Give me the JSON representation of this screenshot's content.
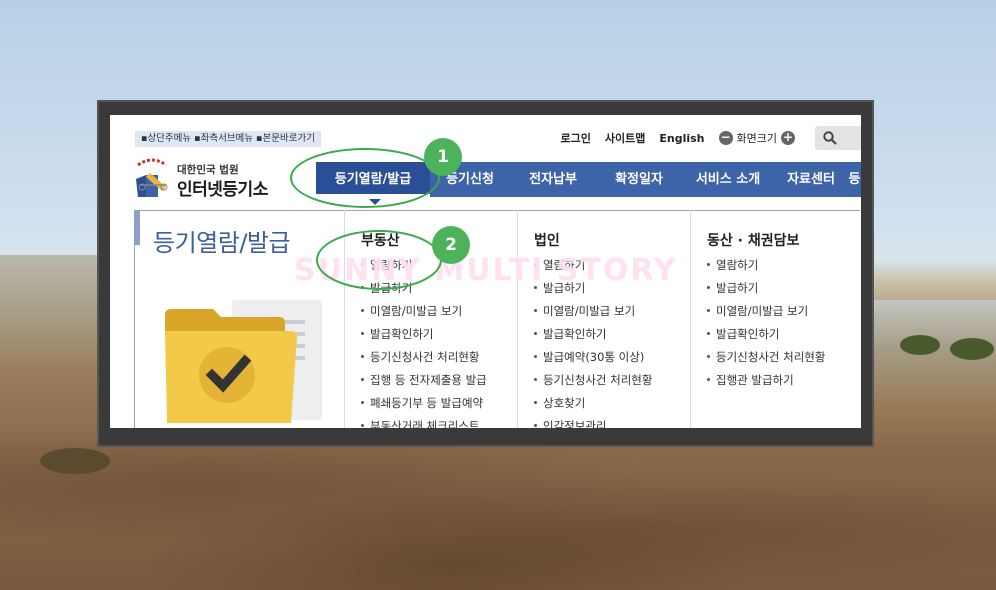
{
  "skip_links": "▪상단주메뉴 ▪좌측서브메뉴 ▪본문바로가기",
  "utility": {
    "login": "로그인",
    "sitemap": "사이트맵",
    "english": "English",
    "zoom_minus": "−",
    "zoom_label": "화면크기",
    "zoom_plus": "+"
  },
  "logo": {
    "court": "대한민국 법원",
    "site": "인터넷등기소"
  },
  "nav": [
    "등기열람/발급",
    "등기신청",
    "전자납부",
    "확정일자",
    "서비스 소개",
    "자료센터",
    "등"
  ],
  "side_title": "등기열람/발급",
  "columns": [
    {
      "title": "부동산",
      "items": [
        "열람하기",
        "발급하기",
        "미열람/미발급 보기",
        "발급확인하기",
        "등기신청사건 처리현황",
        "집행 등 전자제출용 발급",
        "폐쇄등기부 등 발급예약",
        "부동산거래 체크리스트"
      ]
    },
    {
      "title": "법인",
      "items": [
        "열람하기",
        "발급하기",
        "미열람/미발급 보기",
        "발급확인하기",
        "발급예약(30통 이상)",
        "등기신청사건 처리현황",
        "상호찾기",
        "인감정보관리"
      ]
    },
    {
      "title": "동산 · 채권담보",
      "items": [
        "열람하기",
        "발급하기",
        "미열람/미발급 보기",
        "발급확인하기",
        "등기신청사건 처리현황",
        "집행관 발급하기"
      ]
    }
  ],
  "annotations": [
    "1",
    "2"
  ],
  "watermark": "SUNNY MULTI STORY",
  "colors": {
    "nav_bg": "#3d63a8",
    "annotation": "#4cb35a",
    "title": "#3d5f9e"
  }
}
